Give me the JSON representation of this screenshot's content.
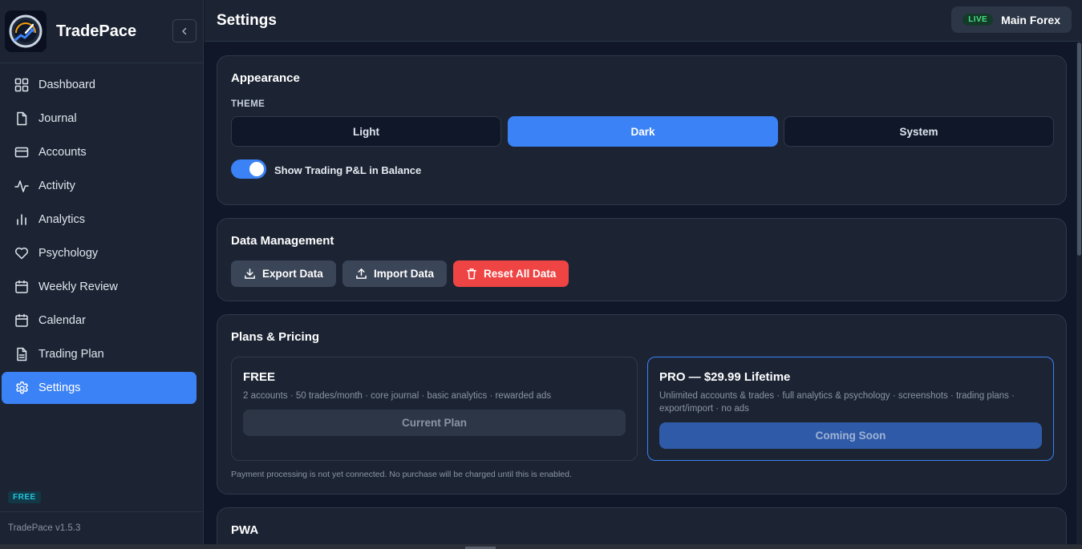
{
  "app": {
    "name": "TradePace",
    "version": "TradePace v1.5.3",
    "tier": "FREE"
  },
  "colors": {
    "accent": "#3b82f6",
    "danger": "#ef4444",
    "live": "#4ade80",
    "background": "#0f1729",
    "surface": "#1c2433"
  },
  "sidebar": {
    "items": [
      {
        "label": "Dashboard",
        "icon": "grid-icon"
      },
      {
        "label": "Journal",
        "icon": "document-icon"
      },
      {
        "label": "Accounts",
        "icon": "credit-card-icon"
      },
      {
        "label": "Activity",
        "icon": "activity-icon"
      },
      {
        "label": "Analytics",
        "icon": "bar-chart-icon"
      },
      {
        "label": "Psychology",
        "icon": "heart-icon"
      },
      {
        "label": "Weekly Review",
        "icon": "calendar-icon"
      },
      {
        "label": "Calendar",
        "icon": "calendar-icon"
      },
      {
        "label": "Trading Plan",
        "icon": "file-text-icon"
      },
      {
        "label": "Settings",
        "icon": "gear-icon",
        "active": true
      }
    ]
  },
  "header": {
    "title": "Settings",
    "account": {
      "status": "LIVE",
      "name": "Main Forex"
    }
  },
  "appearance": {
    "title": "Appearance",
    "theme_label": "THEME",
    "themes": [
      "Light",
      "Dark",
      "System"
    ],
    "selected_theme": "Dark",
    "toggle_label": "Show Trading P&L in Balance",
    "toggle_on": true
  },
  "data_management": {
    "title": "Data Management",
    "export_label": "Export Data",
    "import_label": "Import Data",
    "reset_label": "Reset All Data"
  },
  "pricing": {
    "title": "Plans & Pricing",
    "free": {
      "name": "FREE",
      "description": "2 accounts · 50 trades/month · core journal · basic analytics · rewarded ads",
      "button": "Current Plan"
    },
    "pro": {
      "name": "PRO — $29.99 Lifetime",
      "description": "Unlimited accounts & trades · full analytics & psychology · screenshots · trading plans · export/import · no ads",
      "button": "Coming Soon"
    },
    "note": "Payment processing is not yet connected. No purchase will be charged until this is enabled."
  },
  "pwa": {
    "title": "PWA"
  }
}
